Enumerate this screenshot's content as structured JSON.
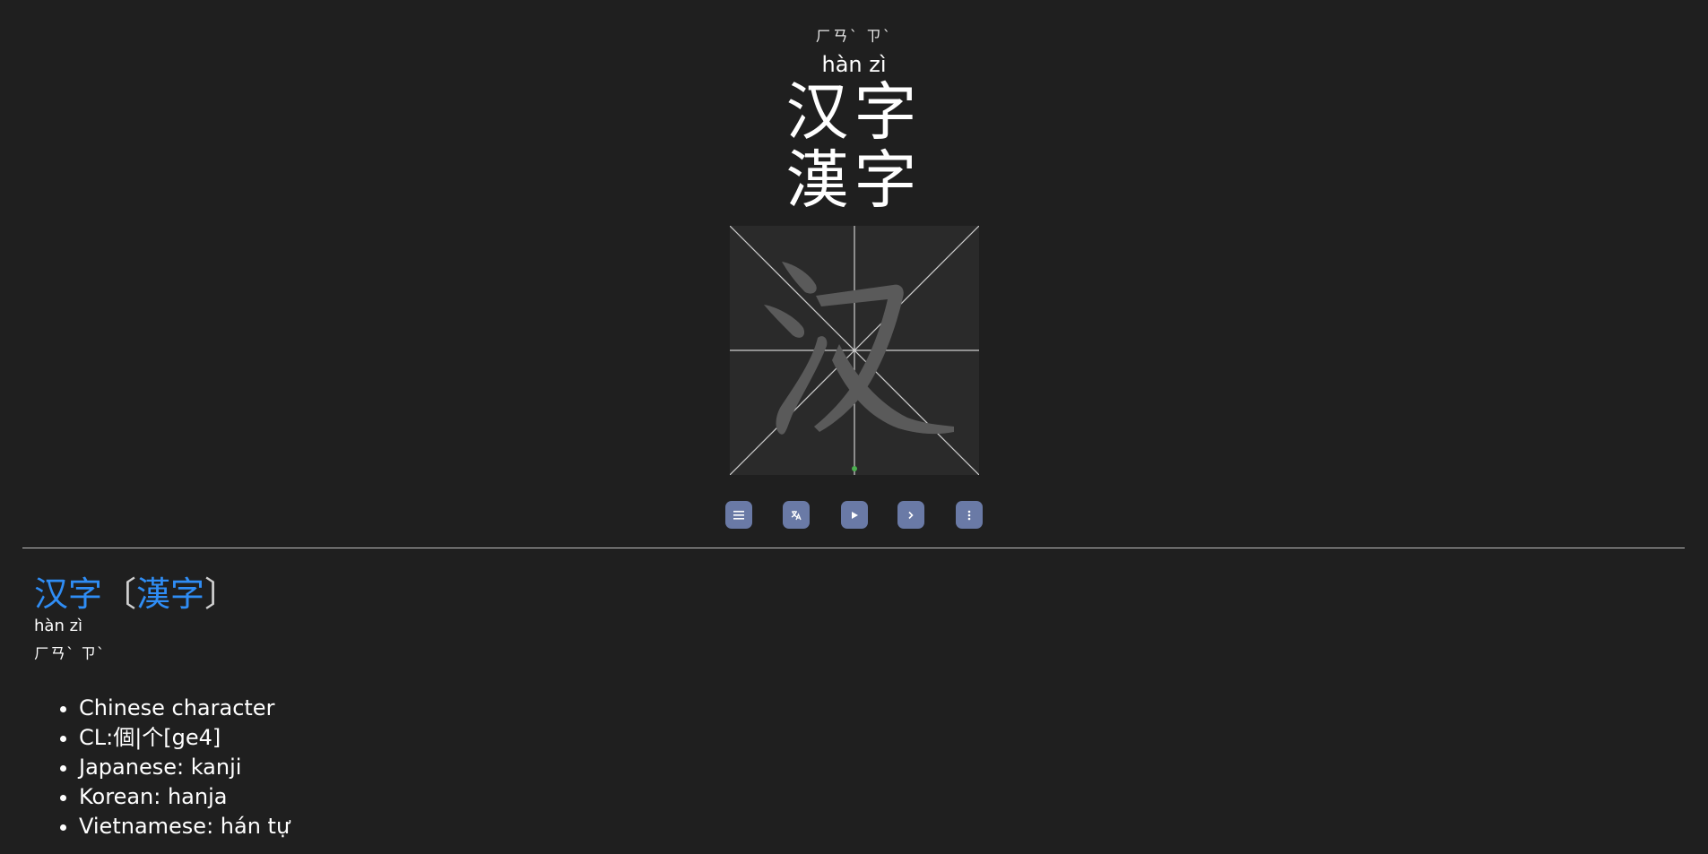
{
  "header": {
    "zhuyin": "ㄏㄢˋ ㄗˋ",
    "pinyin": "hàn zì",
    "simplified": "汉字",
    "traditional": "漢字"
  },
  "stroke_board": {
    "character": "汉"
  },
  "controls": [
    {
      "label": "menu",
      "icon": "menu-icon"
    },
    {
      "label": "switch script",
      "icon": "translate-icon"
    },
    {
      "label": "play",
      "icon": "play-icon"
    },
    {
      "label": "next",
      "icon": "chevron-right-icon"
    },
    {
      "label": "more",
      "icon": "more-vertical-icon"
    }
  ],
  "entry": {
    "simplified": "汉字",
    "traditional": "漢字",
    "bracket_open": "〔",
    "bracket_close": "〕",
    "pinyin": "hàn zì",
    "zhuyin": "ㄏㄢˋ ㄗˋ",
    "definitions": [
      "Chinese character",
      "CL:個|个[ge4]",
      "Japanese: kanji",
      "Korean: hanja",
      "Vietnamese: hán tự"
    ]
  },
  "colors": {
    "background": "#1f1f1f",
    "link": "#2f8df5",
    "button": "#6a7aa6",
    "stroke_ghost": "#5a5a5a",
    "start_dot": "#4caf50"
  }
}
